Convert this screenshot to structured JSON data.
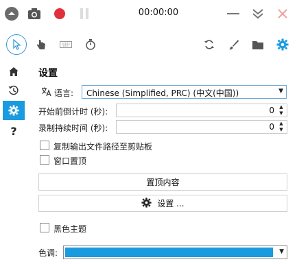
{
  "titlebar": {
    "timer": "00:00:00",
    "icons": [
      "chevron-up-circle-icon",
      "camera-icon",
      "record-icon",
      "pause-icon",
      "minimize-icon",
      "collapse-icon",
      "close-icon"
    ]
  },
  "toolbar": {
    "tools": [
      "pointer-icon",
      "hand-icon",
      "keyboard-icon",
      "stopwatch-icon",
      "refresh-icon",
      "brush-icon",
      "folder-icon",
      "gear-icon"
    ]
  },
  "sidebar": {
    "items": [
      "home-icon",
      "history-icon",
      "gear-icon",
      "help-icon"
    ],
    "help_label": "?"
  },
  "settings": {
    "title": "设置",
    "language_label": "语言:",
    "language_value": "Chinese (Simplified, PRC) (中文(中国))",
    "countdown_label": "开始前倒计时 (秒):",
    "countdown_value": "0",
    "duration_label": "录制持续时间 (秒):",
    "duration_value": "0",
    "copy_path_label": "复制输出文件路径至剪贴板",
    "topmost_label": "窗口置顶",
    "topmost_content_button": "置顶内容",
    "settings_button": "设置 ...",
    "dark_theme_label": "黑色主题",
    "accent_label": "色调:"
  },
  "colors": {
    "accent": "#1a9be0",
    "record": "#e0303c",
    "close": "#f0a0a0"
  }
}
